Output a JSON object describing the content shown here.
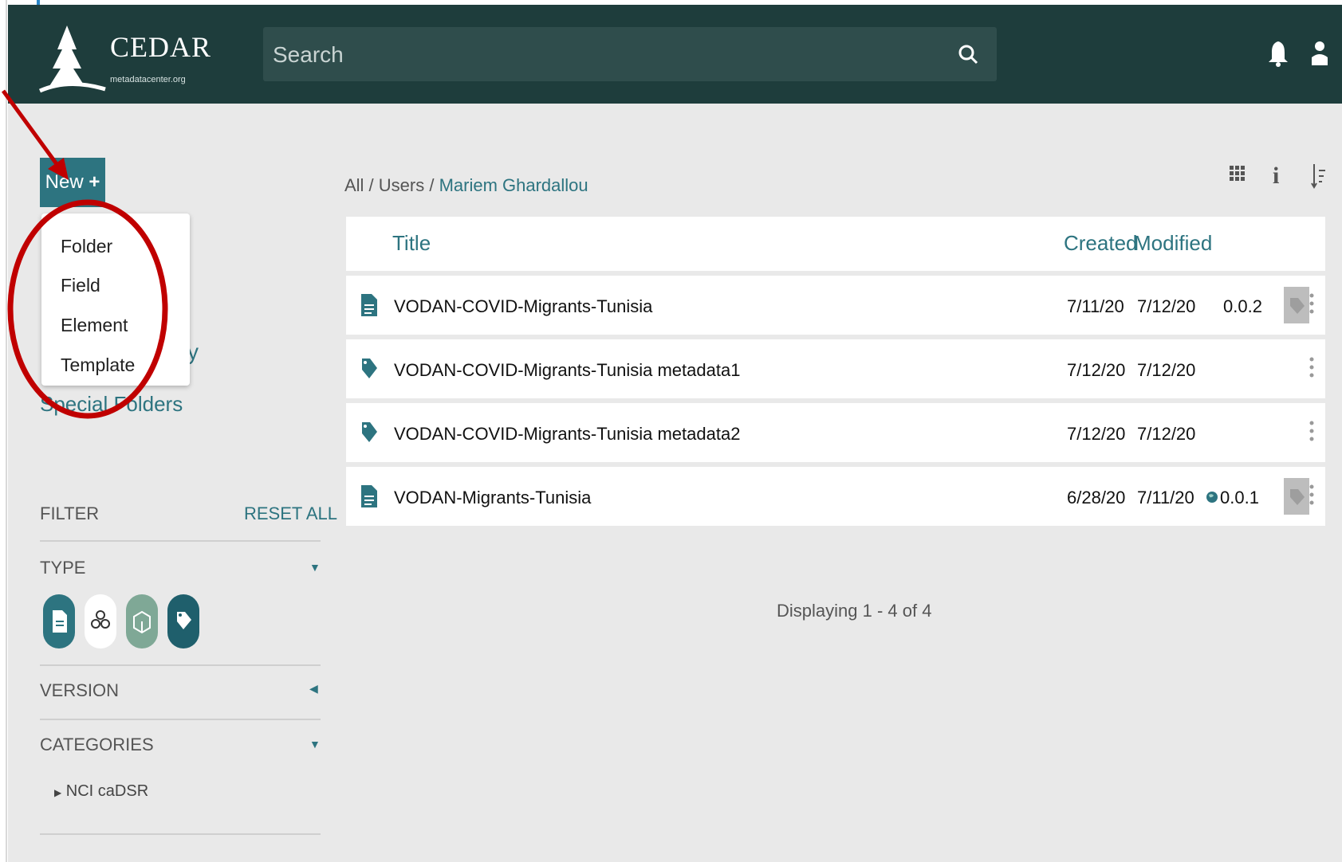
{
  "header": {
    "logo_title": "CEDAR",
    "logo_subtitle": "metadatacenter.org",
    "search_placeholder": "Search",
    "icons": [
      "search-icon",
      "bell-icon",
      "user-icon"
    ]
  },
  "sidebar": {
    "new_label": "New",
    "new_menu": [
      "Folder",
      "Field",
      "Element",
      "Template"
    ],
    "partial_text": "y",
    "special_folders": "Special Folders",
    "filter_label": "FILTER",
    "reset_label": "RESET ALL",
    "type_label": "TYPE",
    "type_icons": [
      "template-icon",
      "element-icon",
      "field-icon",
      "instance-icon"
    ],
    "version_label": "VERSION",
    "categories_label": "CATEGORIES",
    "category_items": [
      "NCI caDSR"
    ]
  },
  "breadcrumb": {
    "prefix": "All / Users / ",
    "current": "Mariem Ghardallou"
  },
  "toolbar_icons": [
    "grid-view-icon",
    "info-icon",
    "sort-icon"
  ],
  "table": {
    "headers": {
      "title": "Title",
      "created": "Created",
      "modified": "Modified"
    },
    "rows": [
      {
        "icon": "template-icon",
        "title": "VODAN-COVID-Migrants-Tunisia",
        "created": "7/11/20",
        "modified": "7/12/20",
        "version": "0.0.2",
        "published": false,
        "tag": true
      },
      {
        "icon": "instance-icon",
        "title": "VODAN-COVID-Migrants-Tunisia metadata1",
        "created": "7/12/20",
        "modified": "7/12/20",
        "version": "",
        "published": false,
        "tag": false
      },
      {
        "icon": "instance-icon",
        "title": "VODAN-COVID-Migrants-Tunisia metadata2",
        "created": "7/12/20",
        "modified": "7/12/20",
        "version": "",
        "published": false,
        "tag": false
      },
      {
        "icon": "template-icon",
        "title": "VODAN-Migrants-Tunisia",
        "created": "6/28/20",
        "modified": "7/11/20",
        "version": "0.0.1",
        "published": true,
        "tag": true
      }
    ],
    "footer": "Displaying 1 - 4 of 4"
  },
  "colors": {
    "header": "#1e3d3c",
    "accent": "#2d7480",
    "annotation": "#c00000"
  }
}
